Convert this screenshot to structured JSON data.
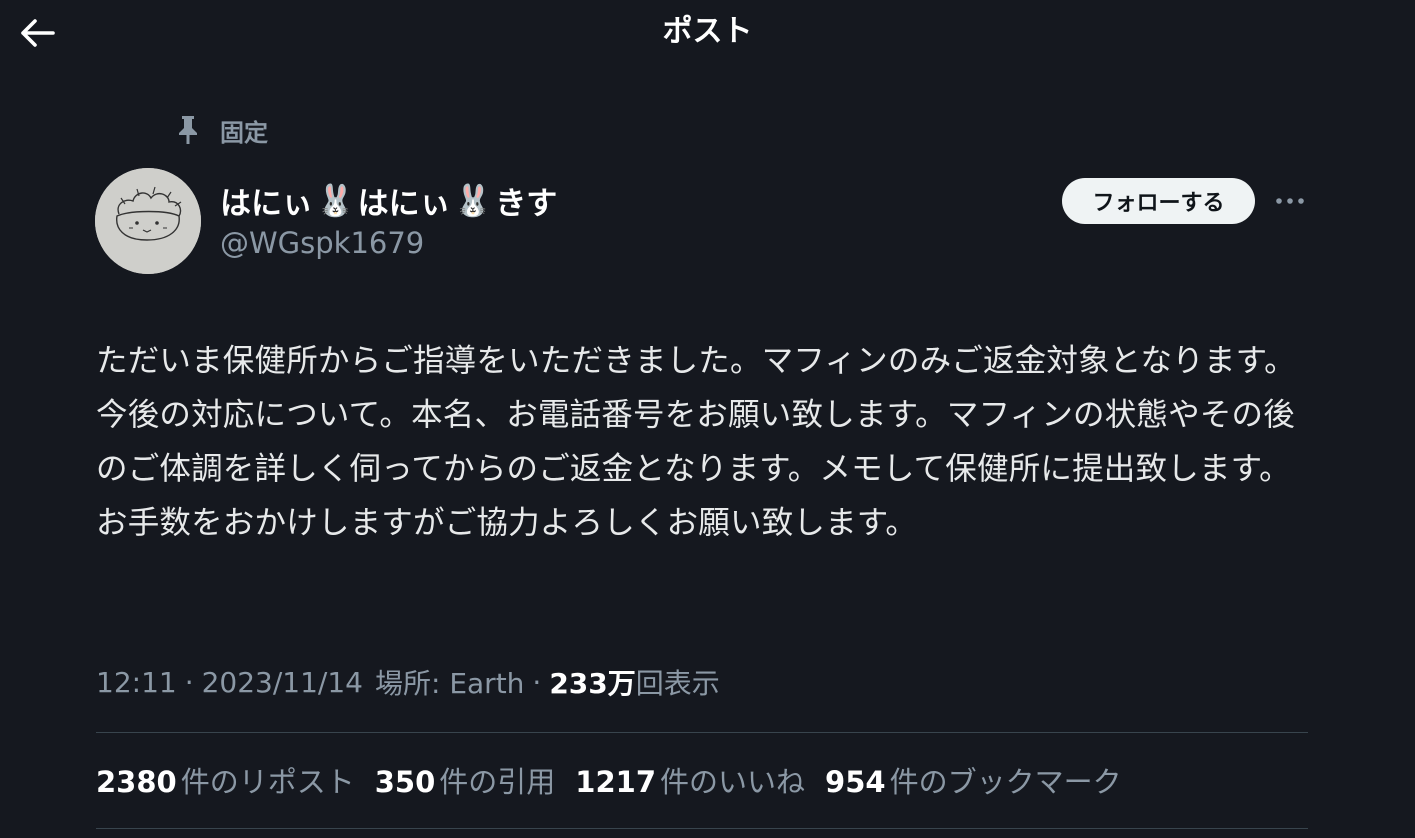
{
  "header": {
    "title": "ポスト"
  },
  "pinned": {
    "label": "固定"
  },
  "author": {
    "name_part1": "はにぃ",
    "emoji1": "🐰",
    "name_part2": "はにぃ",
    "emoji2": "🐰",
    "name_part3": "きす",
    "handle": "@WGspk1679"
  },
  "actions": {
    "follow_label": "フォローする",
    "more_label": "···"
  },
  "post": {
    "text": "ただいま保健所からご指導をいただきました。マフィンのみご返金対象となります。今後の対応について。本名、お電話番号をお願い致します。マフィンの状態やその後のご体調を詳しく伺ってからのご返金となります。メモして保健所に提出致します。お手数をおかけしますがご協力よろしくお願い致します。"
  },
  "meta": {
    "time": "12:11",
    "date": "2023/11/14",
    "location": "場所: Earth",
    "views_count": "233万",
    "views_label": "回表示"
  },
  "stats": [
    {
      "count": "2380",
      "label": "件のリポスト"
    },
    {
      "count": "350",
      "label": "件の引用"
    },
    {
      "count": "1217",
      "label": "件のいいね"
    },
    {
      "count": "954",
      "label": "件のブックマーク"
    }
  ],
  "colors": {
    "background": "#15181f",
    "text_primary": "#e7e9ea",
    "text_secondary": "#8b98a5",
    "follow_button_bg": "#eff3f4",
    "divider": "#38444d"
  },
  "icons": {
    "back": "arrow-left-icon",
    "pin": "pin-icon",
    "more": "more-horizontal-icon"
  }
}
